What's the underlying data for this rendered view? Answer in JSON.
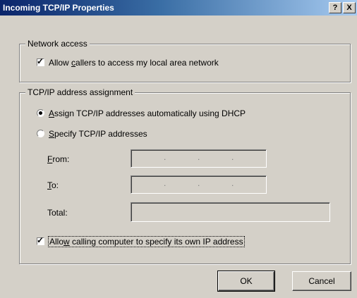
{
  "window": {
    "title": "Incoming TCP/IP Properties",
    "help_button": "?",
    "close_button": "X"
  },
  "network_access": {
    "legend": "Network access",
    "allow_callers": {
      "label_pre": "Allow ",
      "label_key": "c",
      "label_post": "allers to access my local area network",
      "checked": true
    }
  },
  "ip_assignment": {
    "legend": "TCP/IP address assignment",
    "auto_dhcp": {
      "label_key": "A",
      "label_post": "ssign TCP/IP addresses automatically using DHCP",
      "selected": true
    },
    "specify": {
      "label_key": "S",
      "label_post": "pecify TCP/IP addresses",
      "selected": false
    },
    "from": {
      "label_key": "F",
      "label_post": "rom:"
    },
    "to": {
      "label_key": "T",
      "label_post": "o:"
    },
    "total": {
      "label": "Total:"
    },
    "ip_dots": "."
  },
  "allow_own_ip": {
    "label_pre": "Allo",
    "label_key": "w",
    "label_post": " calling computer to specify its own IP address",
    "checked": true
  },
  "buttons": {
    "ok": "OK",
    "cancel": "Cancel"
  },
  "check_glyph": "✓"
}
